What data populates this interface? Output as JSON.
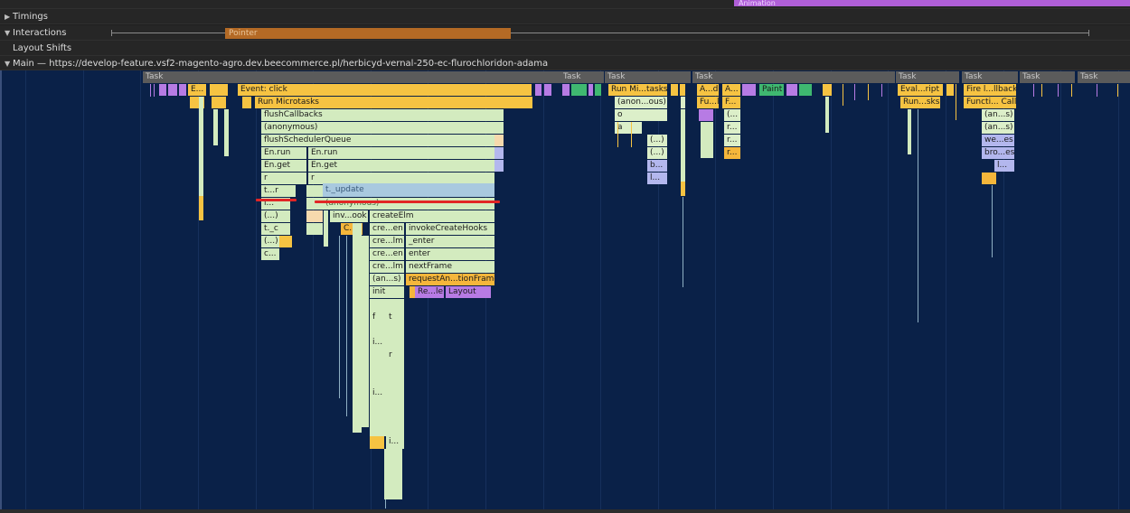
{
  "tracks": {
    "animation_label": "Animation",
    "timings": "Timings",
    "interactions": "Interactions",
    "pointer_label": "Pointer",
    "layout_shifts": "Layout Shifts",
    "main_title": "Main — https://develop-feature.vsf2-magento-agro.dev.beecommerce.pl/herbicyd-vernal-250-ec-flurochloridon-adama"
  },
  "task_label": "Task",
  "flame": {
    "event_click": "Event: click",
    "e_short": "E...",
    "run_microtasks": "Run Microtasks",
    "flush_callbacks": "flushCallbacks",
    "anonymous": "(anonymous)",
    "flush_scheduler_queue": "flushSchedulerQueue",
    "en_run": "En.run",
    "en_get": "En.get",
    "r": "r",
    "t_update": "t._update",
    "t_r": "t...r",
    "dots": "(...)",
    "t_c": "t._c",
    "c_dots": "c...",
    "i_dots": "i...",
    "inv_ook": "inv...ook",
    "create_elm": "createElm",
    "c_short": "C...",
    "cre_en": "cre...en",
    "cre_lm": "cre...lm",
    "invoke_create_hooks": "invokeCreateHooks",
    "enter_u": "_enter",
    "enter": "enter",
    "next_frame": "nextFrame",
    "an_s": "(an...s)",
    "request_anim": "requestAn...tionFrame",
    "init": "init",
    "re_le": "Re...le",
    "layout": "Layout",
    "f": "f",
    "t": "t",
    "run_mi_tasks": "Run Mi...tasks",
    "anon_ous": "(anon...ous)",
    "o": "o",
    "a": "a",
    "b_dots": "b...",
    "l_dots": "l...",
    "a_d": "A...d",
    "a_short": "A...",
    "fu_l": "Fu...l",
    "f_short": "F...",
    "paren_dots": "(...",
    "r_dots": "r...",
    "paint": "Paint",
    "eval_ript": "Eval...ript",
    "run_sks": "Run...sks",
    "fire_llback": "Fire l...llback",
    "functi_call": "Functi... Call",
    "an_s2": "(an...s)",
    "we_es": "we...es",
    "bro_es": "bro...es",
    "l_short": "l..."
  },
  "colors": {
    "background": "#0a2148",
    "task": "#5b5b5b",
    "scripting": "#f6c342",
    "function": "#d3ebbf",
    "rendering": "#b77be4",
    "painting": "#3fb870",
    "annotation": "#e12525"
  }
}
